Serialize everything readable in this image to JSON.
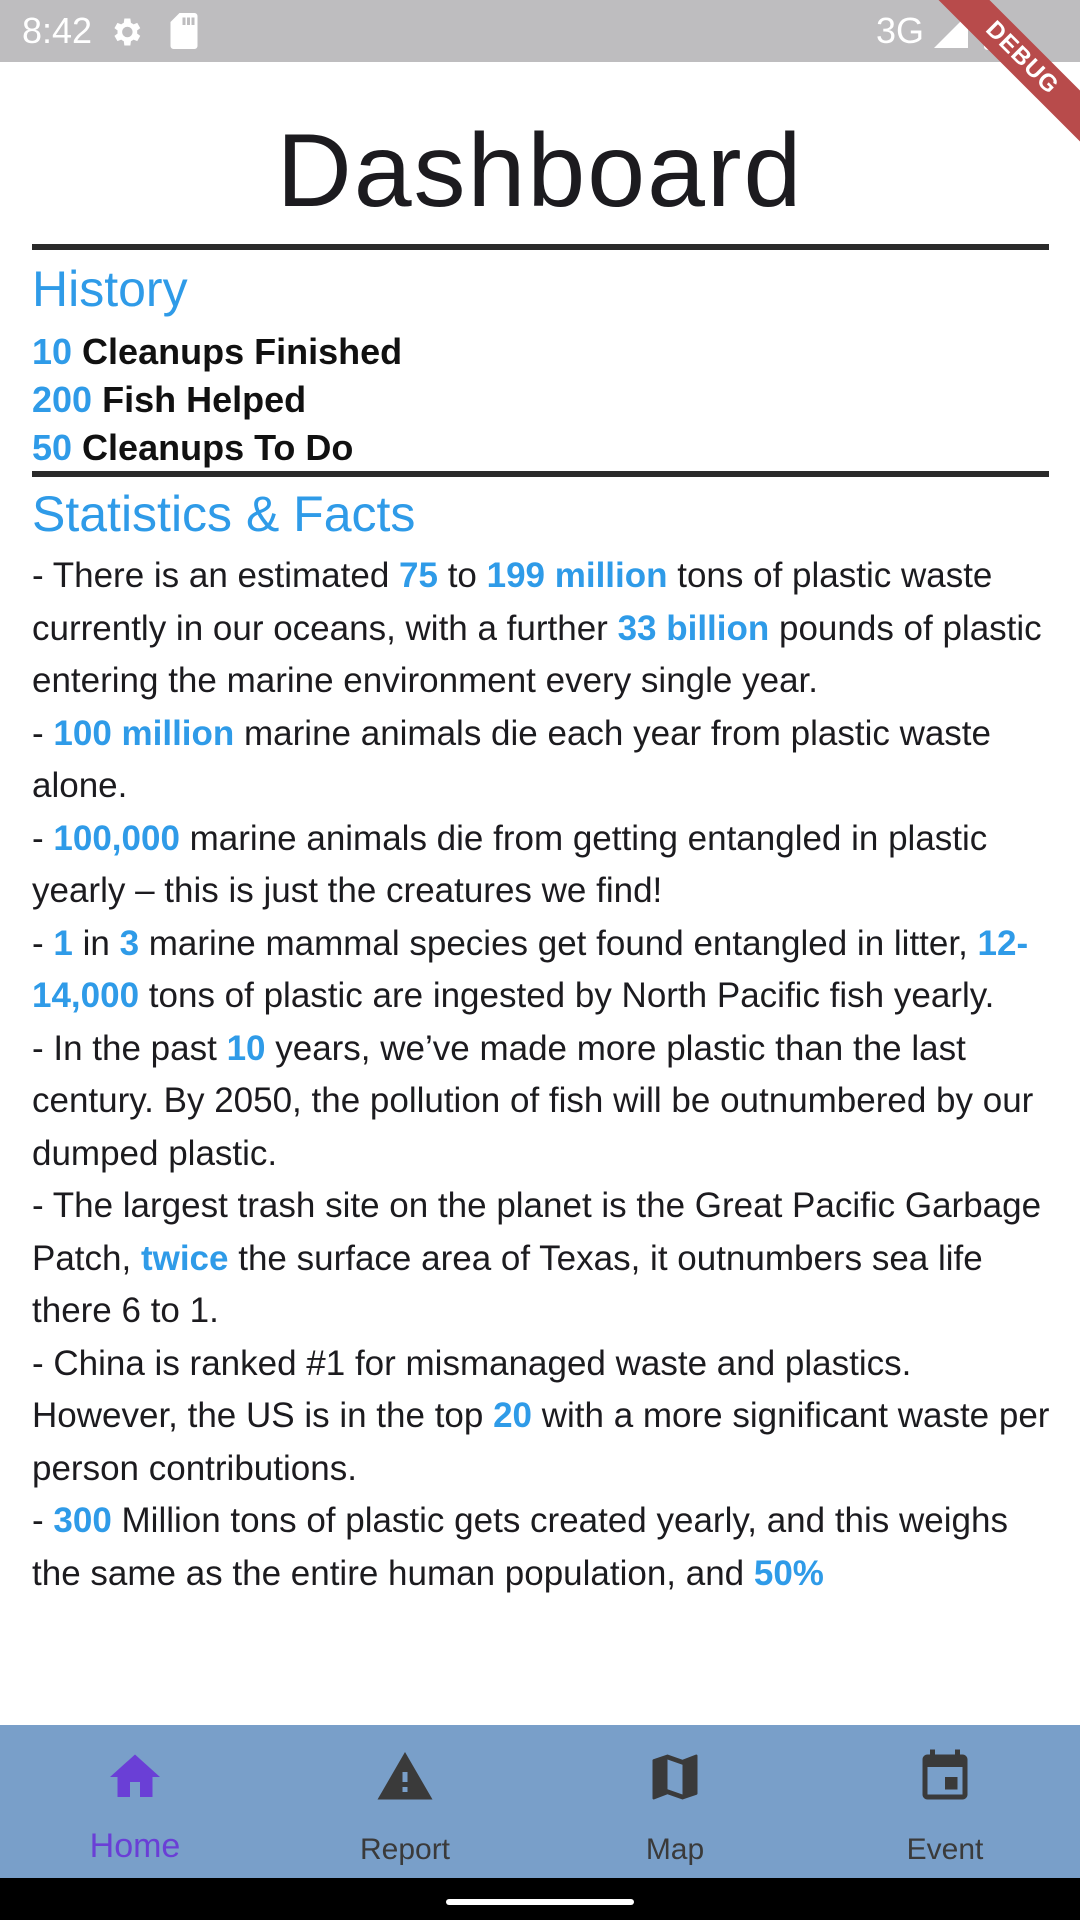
{
  "status_bar": {
    "time": "8:42",
    "network": "3G",
    "icons": [
      "gear-icon",
      "sd-card-icon",
      "signal-icon",
      "battery-icon"
    ]
  },
  "debug_banner": "DEBUG",
  "page": {
    "title": "Dashboard"
  },
  "history": {
    "title": "History",
    "rows": [
      {
        "value": "10",
        "label": " Cleanups Finished"
      },
      {
        "value": "200",
        "label": " Fish Helped"
      },
      {
        "value": "50",
        "label": " Cleanups To Do"
      }
    ]
  },
  "stats": {
    "title": "Statistics & Facts",
    "facts": [
      [
        {
          "t": "- There is an estimated "
        },
        {
          "t": "75",
          "h": true
        },
        {
          "t": " to "
        },
        {
          "t": "199 million",
          "h": true
        },
        {
          "t": " tons of plastic waste currently in our oceans, with a further "
        },
        {
          "t": "33 billion",
          "h": true
        },
        {
          "t": " pounds of plastic entering the marine environment every single year."
        }
      ],
      [
        {
          "t": "- "
        },
        {
          "t": "100 million",
          "h": true
        },
        {
          "t": " marine animals die each year from plastic waste alone."
        }
      ],
      [
        {
          "t": "- "
        },
        {
          "t": "100,000",
          "h": true
        },
        {
          "t": " marine animals die from getting entangled in plastic yearly – this is just the creatures we find!"
        }
      ],
      [
        {
          "t": "- "
        },
        {
          "t": "1",
          "h": true
        },
        {
          "t": " in "
        },
        {
          "t": "3",
          "h": true
        },
        {
          "t": " marine mammal species get found entangled in litter, "
        },
        {
          "t": "12-14,000",
          "h": true
        },
        {
          "t": " tons of plastic are ingested by North Pacific fish yearly."
        }
      ],
      [
        {
          "t": "- In the past "
        },
        {
          "t": "10",
          "h": true
        },
        {
          "t": " years, we’ve made more plastic than the last century. By 2050, the pollution of fish will be outnumbered by our dumped plastic."
        }
      ],
      [
        {
          "t": "- The largest trash site on the planet is the Great Pacific Garbage Patch, "
        },
        {
          "t": "twice",
          "h": true
        },
        {
          "t": " the surface area of Texas, it outnumbers sea life there 6 to 1."
        }
      ],
      [
        {
          "t": "- China is ranked #1 for mismanaged waste and plastics. However, the US is in the top "
        },
        {
          "t": "20",
          "h": true
        },
        {
          "t": " with a more significant waste per person contributions."
        }
      ],
      [
        {
          "t": "- "
        },
        {
          "t": "300",
          "h": true
        },
        {
          "t": " Million tons of plastic gets created yearly, and this weighs the same as the entire human population, and "
        },
        {
          "t": "50%",
          "h": true
        }
      ]
    ]
  },
  "bottom_nav": {
    "items": [
      {
        "label": "Home",
        "icon": "home-icon",
        "active": true
      },
      {
        "label": "Report",
        "icon": "warning-icon",
        "active": false
      },
      {
        "label": "Map",
        "icon": "map-icon",
        "active": false
      },
      {
        "label": "Event",
        "icon": "calendar-icon",
        "active": false
      }
    ]
  },
  "colors": {
    "accent": "#2f9be8",
    "nav_background": "#799fc9",
    "nav_active": "#6a3fd6",
    "status_bar": "#bebdbf",
    "debug_ribbon": "#b84b4b"
  }
}
